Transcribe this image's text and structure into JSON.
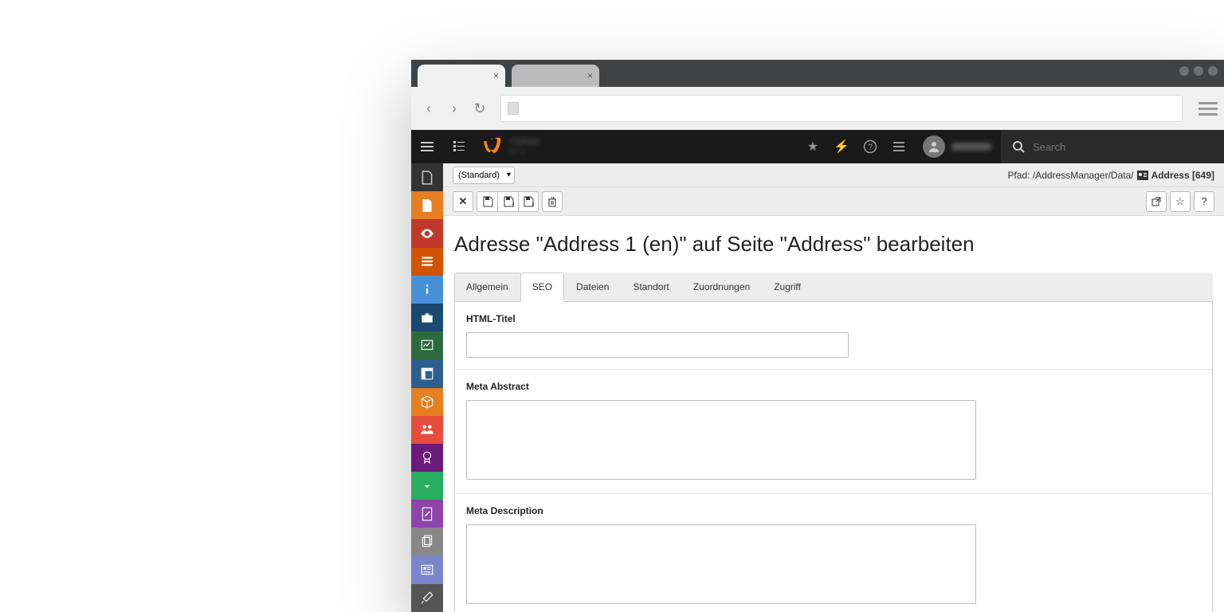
{
  "browser": {
    "tab_close": "×"
  },
  "topbar": {
    "search_placeholder": "Search"
  },
  "breadcrumb": {
    "dropdown_value": "(Standard)",
    "path_prefix": "Pfad: /AddressManager/Data/",
    "record_label": "Address [649]"
  },
  "page": {
    "heading": "Adresse \"Address 1 (en)\" auf Seite \"Address\" bearbeiten"
  },
  "tabs": {
    "allgemein": "Allgemein",
    "seo": "SEO",
    "dateien": "Dateien",
    "standort": "Standort",
    "zuordnungen": "Zuordnungen",
    "zugriff": "Zugriff"
  },
  "form": {
    "html_title_label": "HTML-Titel",
    "html_title_value": "",
    "meta_abstract_label": "Meta Abstract",
    "meta_abstract_value": "",
    "meta_description_label": "Meta Description",
    "meta_description_value": ""
  },
  "module_icons": [
    "file-icon",
    "page-icon",
    "view-icon",
    "list-icon",
    "info-icon",
    "workspace-icon",
    "stats-icon",
    "template-icon",
    "package-icon",
    "users-icon",
    "badge-icon",
    "download-icon",
    "edit-icon",
    "copy-icon",
    "news-icon",
    "tool-icon"
  ]
}
